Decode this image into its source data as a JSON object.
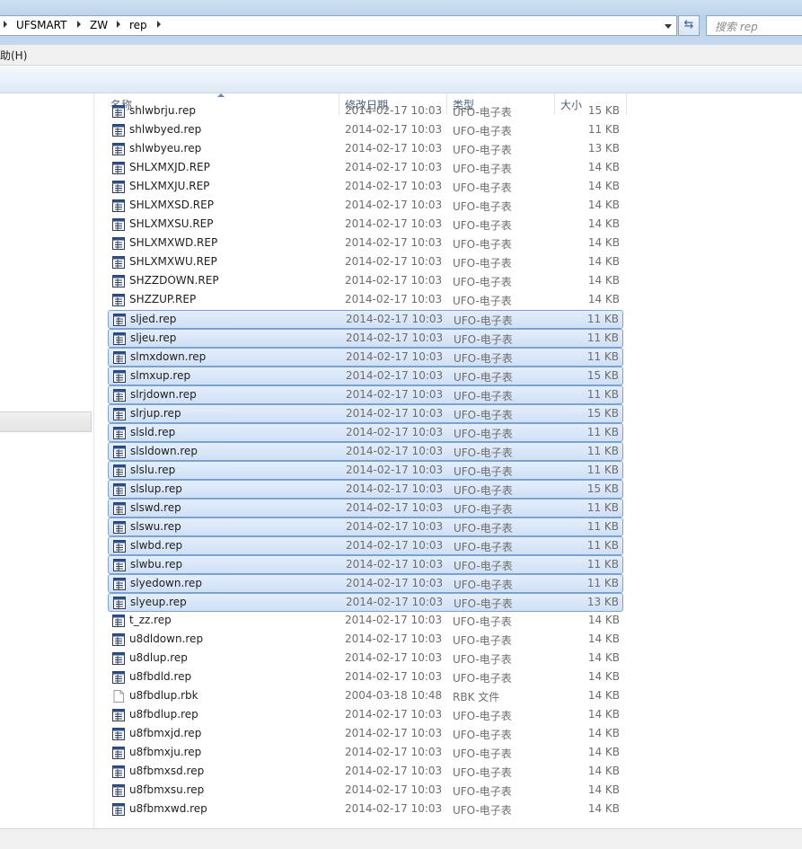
{
  "address": {
    "crumbs": [
      "UFSMART",
      "ZW",
      "rep"
    ],
    "search_placeholder": "搜索 rep"
  },
  "menu": {
    "help_label": "助(H)"
  },
  "columns": {
    "name": "名称",
    "date": "修改日期",
    "type": "类型",
    "size": "大小"
  },
  "icons": {
    "rep": "ufo-report-file-icon",
    "rbk": "generic-file-icon"
  },
  "files": [
    {
      "name": "shlwbrju.rep",
      "date": "2014-02-17 10:03",
      "type": "UFO-电子表",
      "size": "15 KB",
      "icon": "rep",
      "selected": false
    },
    {
      "name": "shlwbyed.rep",
      "date": "2014-02-17 10:03",
      "type": "UFO-电子表",
      "size": "11 KB",
      "icon": "rep",
      "selected": false
    },
    {
      "name": "shlwbyeu.rep",
      "date": "2014-02-17 10:03",
      "type": "UFO-电子表",
      "size": "13 KB",
      "icon": "rep",
      "selected": false
    },
    {
      "name": "SHLXMXJD.REP",
      "date": "2014-02-17 10:03",
      "type": "UFO-电子表",
      "size": "14 KB",
      "icon": "rep",
      "selected": false
    },
    {
      "name": "SHLXMXJU.REP",
      "date": "2014-02-17 10:03",
      "type": "UFO-电子表",
      "size": "14 KB",
      "icon": "rep",
      "selected": false
    },
    {
      "name": "SHLXMXSD.REP",
      "date": "2014-02-17 10:03",
      "type": "UFO-电子表",
      "size": "14 KB",
      "icon": "rep",
      "selected": false
    },
    {
      "name": "SHLXMXSU.REP",
      "date": "2014-02-17 10:03",
      "type": "UFO-电子表",
      "size": "14 KB",
      "icon": "rep",
      "selected": false
    },
    {
      "name": "SHLXMXWD.REP",
      "date": "2014-02-17 10:03",
      "type": "UFO-电子表",
      "size": "14 KB",
      "icon": "rep",
      "selected": false
    },
    {
      "name": "SHLXMXWU.REP",
      "date": "2014-02-17 10:03",
      "type": "UFO-电子表",
      "size": "14 KB",
      "icon": "rep",
      "selected": false
    },
    {
      "name": "SHZZDOWN.REP",
      "date": "2014-02-17 10:03",
      "type": "UFO-电子表",
      "size": "14 KB",
      "icon": "rep",
      "selected": false
    },
    {
      "name": "SHZZUP.REP",
      "date": "2014-02-17 10:03",
      "type": "UFO-电子表",
      "size": "14 KB",
      "icon": "rep",
      "selected": false
    },
    {
      "name": "sljed.rep",
      "date": "2014-02-17 10:03",
      "type": "UFO-电子表",
      "size": "11 KB",
      "icon": "rep",
      "selected": true
    },
    {
      "name": "sljeu.rep",
      "date": "2014-02-17 10:03",
      "type": "UFO-电子表",
      "size": "11 KB",
      "icon": "rep",
      "selected": true
    },
    {
      "name": "slmxdown.rep",
      "date": "2014-02-17 10:03",
      "type": "UFO-电子表",
      "size": "11 KB",
      "icon": "rep",
      "selected": true
    },
    {
      "name": "slmxup.rep",
      "date": "2014-02-17 10:03",
      "type": "UFO-电子表",
      "size": "15 KB",
      "icon": "rep",
      "selected": true
    },
    {
      "name": "slrjdown.rep",
      "date": "2014-02-17 10:03",
      "type": "UFO-电子表",
      "size": "11 KB",
      "icon": "rep",
      "selected": true
    },
    {
      "name": "slrjup.rep",
      "date": "2014-02-17 10:03",
      "type": "UFO-电子表",
      "size": "15 KB",
      "icon": "rep",
      "selected": true
    },
    {
      "name": "slsld.rep",
      "date": "2014-02-17 10:03",
      "type": "UFO-电子表",
      "size": "11 KB",
      "icon": "rep",
      "selected": true
    },
    {
      "name": "slsldown.rep",
      "date": "2014-02-17 10:03",
      "type": "UFO-电子表",
      "size": "11 KB",
      "icon": "rep",
      "selected": true
    },
    {
      "name": "slslu.rep",
      "date": "2014-02-17 10:03",
      "type": "UFO-电子表",
      "size": "11 KB",
      "icon": "rep",
      "selected": true
    },
    {
      "name": "slslup.rep",
      "date": "2014-02-17 10:03",
      "type": "UFO-电子表",
      "size": "15 KB",
      "icon": "rep",
      "selected": true
    },
    {
      "name": "slswd.rep",
      "date": "2014-02-17 10:03",
      "type": "UFO-电子表",
      "size": "11 KB",
      "icon": "rep",
      "selected": true
    },
    {
      "name": "slswu.rep",
      "date": "2014-02-17 10:03",
      "type": "UFO-电子表",
      "size": "11 KB",
      "icon": "rep",
      "selected": true
    },
    {
      "name": "slwbd.rep",
      "date": "2014-02-17 10:03",
      "type": "UFO-电子表",
      "size": "11 KB",
      "icon": "rep",
      "selected": true
    },
    {
      "name": "slwbu.rep",
      "date": "2014-02-17 10:03",
      "type": "UFO-电子表",
      "size": "11 KB",
      "icon": "rep",
      "selected": true
    },
    {
      "name": "slyedown.rep",
      "date": "2014-02-17 10:03",
      "type": "UFO-电子表",
      "size": "11 KB",
      "icon": "rep",
      "selected": true
    },
    {
      "name": "slyeup.rep",
      "date": "2014-02-17 10:03",
      "type": "UFO-电子表",
      "size": "13 KB",
      "icon": "rep",
      "selected": true
    },
    {
      "name": "t_zz.rep",
      "date": "2014-02-17 10:03",
      "type": "UFO-电子表",
      "size": "14 KB",
      "icon": "rep",
      "selected": false
    },
    {
      "name": "u8dldown.rep",
      "date": "2014-02-17 10:03",
      "type": "UFO-电子表",
      "size": "14 KB",
      "icon": "rep",
      "selected": false
    },
    {
      "name": "u8dlup.rep",
      "date": "2014-02-17 10:03",
      "type": "UFO-电子表",
      "size": "14 KB",
      "icon": "rep",
      "selected": false
    },
    {
      "name": "u8fbdld.rep",
      "date": "2014-02-17 10:03",
      "type": "UFO-电子表",
      "size": "14 KB",
      "icon": "rep",
      "selected": false
    },
    {
      "name": "u8fbdlup.rbk",
      "date": "2004-03-18 10:48",
      "type": "RBK 文件",
      "size": "14 KB",
      "icon": "rbk",
      "selected": false
    },
    {
      "name": "u8fbdlup.rep",
      "date": "2014-02-17 10:03",
      "type": "UFO-电子表",
      "size": "14 KB",
      "icon": "rep",
      "selected": false
    },
    {
      "name": "u8fbmxjd.rep",
      "date": "2014-02-17 10:03",
      "type": "UFO-电子表",
      "size": "14 KB",
      "icon": "rep",
      "selected": false
    },
    {
      "name": "u8fbmxju.rep",
      "date": "2014-02-17 10:03",
      "type": "UFO-电子表",
      "size": "14 KB",
      "icon": "rep",
      "selected": false
    },
    {
      "name": "u8fbmxsd.rep",
      "date": "2014-02-17 10:03",
      "type": "UFO-电子表",
      "size": "14 KB",
      "icon": "rep",
      "selected": false
    },
    {
      "name": "u8fbmxsu.rep",
      "date": "2014-02-17 10:03",
      "type": "UFO-电子表",
      "size": "14 KB",
      "icon": "rep",
      "selected": false
    },
    {
      "name": "u8fbmxwd.rep",
      "date": "2014-02-17 10:03",
      "type": "UFO-电子表",
      "size": "14 KB",
      "icon": "rep",
      "selected": false
    }
  ]
}
